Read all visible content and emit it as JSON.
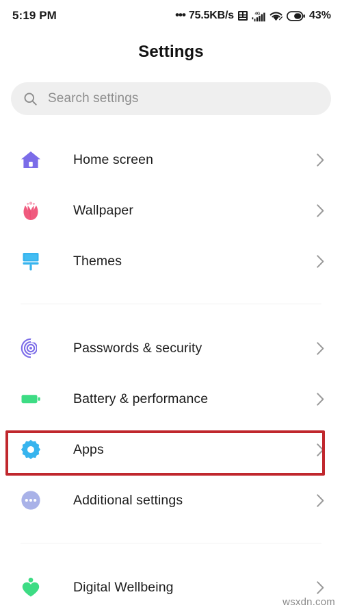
{
  "statusbar": {
    "clock": "5:19 PM",
    "network_dots": "•••",
    "network_speed": "75.5KB/s",
    "sim_icon": "sim-card-icon",
    "signal_icon": "cellular-signal-4g-icon",
    "signal_label": "4G",
    "wifi_icon": "wifi-icon",
    "battery_icon": "battery-icon",
    "battery_percent": "43%"
  },
  "header": {
    "title": "Settings"
  },
  "search": {
    "icon": "search-icon",
    "placeholder": "Search settings",
    "value": ""
  },
  "groups": [
    {
      "id": "personalization",
      "items": [
        {
          "id": "home-screen",
          "label": "Home screen",
          "icon": "house-icon",
          "color": "#7b6ce8",
          "chevron": "chevron-right-icon"
        },
        {
          "id": "wallpaper",
          "label": "Wallpaper",
          "icon": "tulip-flower-icon",
          "color": "#f05a7e",
          "chevron": "chevron-right-icon"
        },
        {
          "id": "themes",
          "label": "Themes",
          "icon": "paint-roller-icon",
          "color": "#37b4ee",
          "chevron": "chevron-right-icon"
        }
      ]
    },
    {
      "id": "system",
      "items": [
        {
          "id": "passwords-security",
          "label": "Passwords & security",
          "icon": "fingerprint-icon",
          "color": "#7b6ce8",
          "chevron": "chevron-right-icon"
        },
        {
          "id": "battery-performance",
          "label": "Battery & performance",
          "icon": "battery-full-icon",
          "color": "#3ddc84",
          "chevron": "chevron-right-icon"
        },
        {
          "id": "apps",
          "label": "Apps",
          "icon": "gear-icon",
          "color": "#37b4ee",
          "chevron": "chevron-right-icon"
        },
        {
          "id": "additional-settings",
          "label": "Additional settings",
          "icon": "three-dots-circle-icon",
          "color": "#a9b2e8",
          "chevron": "chevron-right-icon"
        }
      ]
    },
    {
      "id": "wellbeing",
      "items": [
        {
          "id": "digital-wellbeing",
          "label": "Digital Wellbeing",
          "icon": "heart-person-icon",
          "color": "#3ddc84",
          "chevron": "chevron-right-icon"
        }
      ]
    }
  ],
  "highlight": {
    "target_item": "apps",
    "color": "#c0272d",
    "label": "Apps row highlighted"
  },
  "watermark": {
    "text": "wsxdn.com"
  }
}
